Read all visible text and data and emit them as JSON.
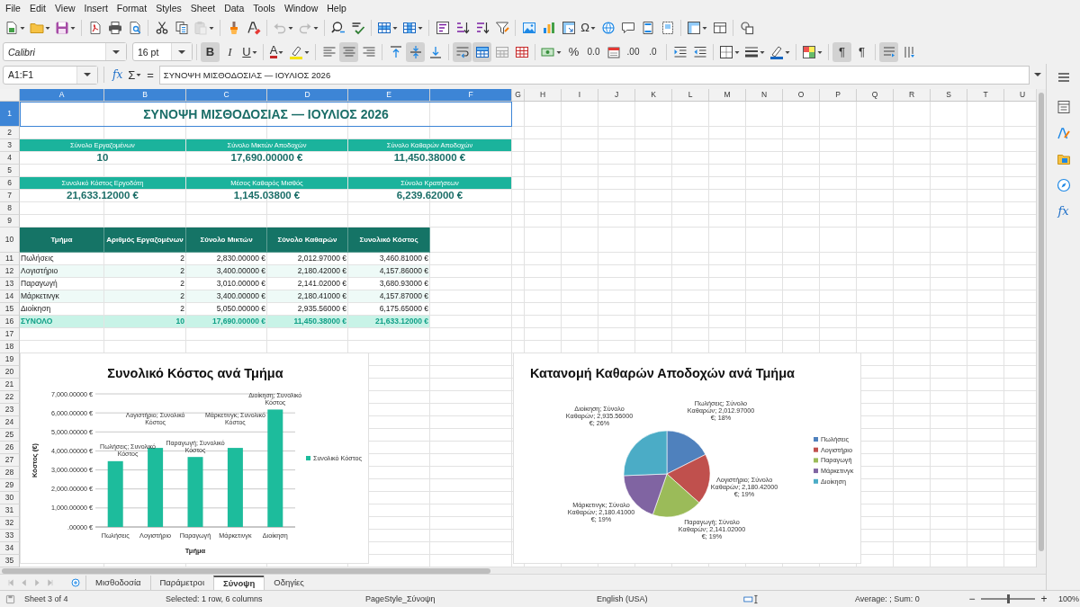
{
  "menu": [
    "File",
    "Edit",
    "View",
    "Insert",
    "Format",
    "Styles",
    "Sheet",
    "Data",
    "Tools",
    "Window",
    "Help"
  ],
  "toolbar_standard": [
    [
      {
        "kind": "new-document",
        "dropdown": true,
        "disabled": false
      },
      {
        "kind": "folder",
        "dropdown": true,
        "disabled": false
      },
      {
        "kind": "save",
        "dropdown": true,
        "disabled": false
      }
    ],
    [
      {
        "kind": "export-pdf",
        "dropdown": false,
        "disabled": false
      },
      {
        "kind": "print",
        "dropdown": false,
        "disabled": false
      },
      {
        "kind": "print-preview",
        "dropdown": false,
        "disabled": false
      }
    ],
    [
      {
        "kind": "cut",
        "dropdown": false,
        "disabled": false
      },
      {
        "kind": "copy",
        "dropdown": false,
        "disabled": false
      },
      {
        "kind": "paste",
        "dropdown": true,
        "disabled": true
      }
    ],
    [
      {
        "kind": "paintbrush",
        "dropdown": false,
        "disabled": false
      },
      {
        "kind": "clear-formatting",
        "dropdown": false,
        "disabled": false
      }
    ],
    [
      {
        "kind": "undo",
        "dropdown": true,
        "disabled": true
      },
      {
        "kind": "redo",
        "dropdown": true,
        "disabled": true
      }
    ],
    [
      {
        "kind": "find-replace",
        "dropdown": false,
        "disabled": false
      },
      {
        "kind": "spelling",
        "dropdown": false,
        "disabled": false
      }
    ],
    [
      {
        "kind": "insert-rows",
        "dropdown": true,
        "disabled": false
      },
      {
        "kind": "insert-columns",
        "dropdown": true,
        "disabled": false
      }
    ],
    [
      {
        "kind": "sort",
        "dropdown": false,
        "disabled": false
      },
      {
        "kind": "sort-ascending",
        "dropdown": false,
        "disabled": false
      },
      {
        "kind": "sort-descending",
        "dropdown": false,
        "disabled": false
      },
      {
        "kind": "filter",
        "dropdown": false,
        "disabled": false
      }
    ],
    [
      {
        "kind": "image",
        "dropdown": false,
        "disabled": false
      },
      {
        "kind": "chart",
        "dropdown": false,
        "disabled": false
      },
      {
        "kind": "pivot-table",
        "dropdown": false,
        "disabled": false
      },
      {
        "kind": "special-character",
        "label": "Ω",
        "dropdown": true,
        "disabled": false
      },
      {
        "kind": "hyperlink",
        "dropdown": false,
        "disabled": false
      },
      {
        "kind": "comment",
        "dropdown": false,
        "disabled": false
      },
      {
        "kind": "header-footer",
        "dropdown": false,
        "disabled": false
      },
      {
        "kind": "print-area",
        "dropdown": false,
        "disabled": false
      }
    ],
    [
      {
        "kind": "freeze",
        "dropdown": true,
        "disabled": false
      },
      {
        "kind": "split-window",
        "dropdown": false,
        "disabled": false
      }
    ],
    [
      {
        "kind": "shapes",
        "dropdown": false,
        "disabled": false
      }
    ]
  ],
  "toolbar_formatting": {
    "font_name": "Calibri",
    "font_size": "16 pt",
    "groups": [
      [
        {
          "kind": "bold",
          "label": "B",
          "dropdown": false,
          "pressed": true
        },
        {
          "kind": "italic",
          "label": "I",
          "dropdown": false,
          "pressed": false
        },
        {
          "kind": "underline",
          "label": "U",
          "dropdown": true,
          "pressed": false
        }
      ],
      [
        {
          "kind": "font-color",
          "label": "A",
          "dropdown": true,
          "pressed": false
        },
        {
          "kind": "highlight",
          "dropdown": true,
          "pressed": false
        }
      ],
      [
        {
          "kind": "align-left",
          "dropdown": false,
          "pressed": false
        },
        {
          "kind": "align-center",
          "dropdown": false,
          "pressed": true
        },
        {
          "kind": "align-right",
          "dropdown": false,
          "pressed": false
        }
      ],
      [
        {
          "kind": "align-top",
          "dropdown": false,
          "pressed": false
        },
        {
          "kind": "align-middle",
          "dropdown": false,
          "pressed": true
        },
        {
          "kind": "align-bottom",
          "dropdown": false,
          "pressed": false
        }
      ],
      [
        {
          "kind": "wrap-text",
          "dropdown": false,
          "pressed": true
        },
        {
          "kind": "merge-center",
          "dropdown": false,
          "pressed": true
        },
        {
          "kind": "merge-cells",
          "dropdown": false,
          "pressed": false
        },
        {
          "kind": "unmerge",
          "dropdown": false,
          "pressed": false
        }
      ],
      [
        {
          "kind": "currency",
          "dropdown": true,
          "pressed": false
        },
        {
          "kind": "percent",
          "label": "%",
          "dropdown": false,
          "pressed": false
        },
        {
          "kind": "number",
          "label": "0.0",
          "dropdown": false,
          "pressed": false
        },
        {
          "kind": "date",
          "dropdown": false,
          "pressed": false
        },
        {
          "kind": "add-decimal",
          "label": ".00",
          "dropdown": false,
          "pressed": false
        },
        {
          "kind": "delete-decimal",
          "label": ".0",
          "dropdown": false,
          "pressed": false
        }
      ],
      [
        {
          "kind": "indent-increase",
          "dropdown": false,
          "pressed": false
        },
        {
          "kind": "indent-decrease",
          "dropdown": false,
          "pressed": false
        }
      ],
      [
        {
          "kind": "borders",
          "dropdown": true,
          "pressed": false
        },
        {
          "kind": "border-style",
          "dropdown": true,
          "pressed": false
        },
        {
          "kind": "border-color",
          "dropdown": true,
          "pressed": false
        }
      ],
      [
        {
          "kind": "conditional",
          "dropdown": true,
          "pressed": false
        }
      ],
      [
        {
          "kind": "left-to-right",
          "label": "¶",
          "dropdown": false,
          "pressed": true
        },
        {
          "kind": "right-to-left",
          "label": "¶",
          "dropdown": false,
          "pressed": false
        }
      ],
      [
        {
          "kind": "text-direction",
          "dropdown": false,
          "pressed": true
        },
        {
          "kind": "vertical-text",
          "dropdown": false,
          "pressed": false
        }
      ]
    ]
  },
  "formula_bar": {
    "cell_reference": "A1:F1",
    "function_wizard": "fx",
    "sum": "Σ",
    "equals": "=",
    "content": "ΣΥΝΟΨΗ ΜΙΣΘΟΔΟΣΙΑΣ — ΙΟΥΛΙΟΣ 2026"
  },
  "sidebar": [
    {
      "kind": "menu"
    },
    {
      "kind": "properties"
    },
    {
      "kind": "styles"
    },
    {
      "kind": "gallery"
    },
    {
      "kind": "navigator"
    },
    {
      "kind": "functions",
      "label": "fx"
    }
  ],
  "sheet": {
    "columns": [
      {
        "label": "A",
        "selected": true
      },
      {
        "label": "B",
        "selected": true
      },
      {
        "label": "C",
        "selected": true
      },
      {
        "label": "D",
        "selected": true
      },
      {
        "label": "E",
        "selected": true
      },
      {
        "label": "F",
        "selected": true
      },
      {
        "label": "G",
        "selected": false
      },
      {
        "label": "H",
        "selected": false
      },
      {
        "label": "I",
        "selected": false
      },
      {
        "label": "J",
        "selected": false
      },
      {
        "label": "K",
        "selected": false
      },
      {
        "label": "L",
        "selected": false
      },
      {
        "label": "M",
        "selected": false
      },
      {
        "label": "N",
        "selected": false
      },
      {
        "label": "O",
        "selected": false
      },
      {
        "label": "P",
        "selected": false
      },
      {
        "label": "Q",
        "selected": false
      },
      {
        "label": "R",
        "selected": false
      },
      {
        "label": "S",
        "selected": false
      },
      {
        "label": "T",
        "selected": false
      },
      {
        "label": "U",
        "selected": false
      }
    ],
    "rows": [
      {
        "label": "1",
        "selected": true
      },
      {
        "label": "2",
        "selected": false
      },
      {
        "label": "3",
        "selected": false
      },
      {
        "label": "4",
        "selected": false
      },
      {
        "label": "5",
        "selected": false
      },
      {
        "label": "6",
        "selected": false
      },
      {
        "label": "7",
        "selected": false
      },
      {
        "label": "8",
        "selected": false
      },
      {
        "label": "9",
        "selected": false
      },
      {
        "label": "10",
        "selected": false
      },
      {
        "label": "11",
        "selected": false
      },
      {
        "label": "12",
        "selected": false
      },
      {
        "label": "13",
        "selected": false
      },
      {
        "label": "14",
        "selected": false
      },
      {
        "label": "15",
        "selected": false
      },
      {
        "label": "16",
        "selected": false
      },
      {
        "label": "17",
        "selected": false
      },
      {
        "label": "18",
        "selected": false
      },
      {
        "label": "19",
        "selected": false
      },
      {
        "label": "20",
        "selected": false
      },
      {
        "label": "21",
        "selected": false
      },
      {
        "label": "22",
        "selected": false
      },
      {
        "label": "23",
        "selected": false
      },
      {
        "label": "24",
        "selected": false
      },
      {
        "label": "25",
        "selected": false
      },
      {
        "label": "26",
        "selected": false
      },
      {
        "label": "27",
        "selected": false
      },
      {
        "label": "28",
        "selected": false
      },
      {
        "label": "29",
        "selected": false
      },
      {
        "label": "30",
        "selected": false
      },
      {
        "label": "31",
        "selected": false
      },
      {
        "label": "32",
        "selected": false
      },
      {
        "label": "33",
        "selected": false
      },
      {
        "label": "34",
        "selected": false
      },
      {
        "label": "35",
        "selected": false
      }
    ],
    "title": "ΣΥΝΟΨΗ ΜΙΣΘΟΔΟΣΙΑΣ — ΙΟΥΛΙΟΣ 2026",
    "kpi_rows": [
      [
        {
          "label": "Σύνολο Εργαζομένων",
          "value": "10"
        },
        {
          "label": "Σύνολο Μικτών Αποδοχών",
          "value": "17,690.00000 €"
        },
        {
          "label": "Σύνολο Καθαρών Αποδοχών",
          "value": "11,450.38000 €"
        }
      ],
      [
        {
          "label": "Συνολικό Κόστος Εργοδότη",
          "value": "21,633.12000 €"
        },
        {
          "label": "Μέσος Καθαρός Μισθός",
          "value": "1,145.03800 €"
        },
        {
          "label": "Σύνολο Κρατήσεων",
          "value": "6,239.62000 €"
        }
      ]
    ],
    "table": {
      "columns": [
        "Τμήμα",
        "Αριθμός Εργαζομένων",
        "Σύνολο Μικτών",
        "Σύνολο Καθαρών",
        "Συνολικό Κόστος"
      ],
      "rows": [
        [
          "Πωλήσεις",
          "2",
          "2,830.00000 €",
          "2,012.97000 €",
          "3,460.81000 €"
        ],
        [
          "Λογιστήριο",
          "2",
          "3,400.00000 €",
          "2,180.42000 €",
          "4,157.86000 €"
        ],
        [
          "Παραγωγή",
          "2",
          "3,010.00000 €",
          "2,141.02000 €",
          "3,680.93000 €"
        ],
        [
          "Μάρκετινγκ",
          "2",
          "3,400.00000 €",
          "2,180.41000 €",
          "4,157.87000 €"
        ],
        [
          "Διοίκηση",
          "2",
          "5,050.00000 €",
          "2,935.56000 €",
          "6,175.65000 €"
        ]
      ],
      "total": [
        "ΣΥΝΟΛΟ",
        "10",
        "17,690.00000 €",
        "11,450.38000 €",
        "21,633.12000 €"
      ]
    }
  },
  "charts": [
    {
      "chart_data": {
        "type": "bar",
        "grid": true,
        "legend": true,
        "title": "Συνολικό Κόστος ανά Τμήμα",
        "xlabel": "Τμήμα",
        "ylabel": "Κόστος (€)",
        "categories": [
          "Πωλήσεις",
          "Λογιστήριο",
          "Παραγωγή",
          "Μάρκετινγκ",
          "Διοίκηση"
        ],
        "series": [
          {
            "name": "Συνολικό Κόστος",
            "color": "#1dbc9c",
            "values": [
              3460.81,
              4157.86,
              3680.93,
              4157.87,
              6175.65
            ]
          }
        ],
        "ylim": [
          0,
          7000
        ],
        "yticks": [
          {
            "value": 0,
            "label": ".00000 €"
          },
          {
            "value": 1000,
            "label": "1,000.00000 €"
          },
          {
            "value": 2000,
            "label": "2,000.00000 €"
          },
          {
            "value": 3000,
            "label": "3,000.00000 €"
          },
          {
            "value": 4000,
            "label": "4,000.00000 €"
          },
          {
            "value": 5000,
            "label": "5,000.00000 €"
          },
          {
            "value": 6000,
            "label": "6,000.00000 €"
          },
          {
            "value": 7000,
            "label": "7,000.00000 €"
          }
        ],
        "value_labels": [
          "Πωλήσεις; Συνολικό Κόστος",
          "Λογιστήριο; Συνολικό Κόστος",
          "Παραγωγή; Συνολικό Κόστος",
          "Μάρκετινγκ; Συνολικό Κόστος",
          "Διοίκηση; Συνολικό Κόστος"
        ]
      }
    },
    {
      "chart_data": {
        "type": "pie",
        "legend": true,
        "title": "Κατανομή Καθαρών Αποδοχών ανά Τμήμα",
        "categories": [
          "Πωλήσεις",
          "Λογιστήριο",
          "Παραγωγή",
          "Μάρκετινγκ",
          "Διοίκηση"
        ],
        "series": [
          {
            "values": [
              17.58,
              19.04,
              18.7,
              19.04,
              25.64
            ],
            "colors": [
              "#4f81bd",
              "#c0504d",
              "#9bbb59",
              "#8064a2",
              "#4bacc6"
            ]
          }
        ],
        "value_labels": [
          "Πωλήσεις; Σύνολο Καθαρών; 2,012.97000 €; 18%",
          "Λογιστήριο; Σύνολο Καθαρών; 2,180.42000 €; 19%",
          "Παραγωγή; Σύνολο Καθαρών; 2,141.02000 €; 19%",
          "Μάρκετινγκ; Σύνολο Καθαρών; 2,180.41000 €; 19%",
          "Διοίκηση; Σύνολο Καθαρών; 2,935.56000 €; 26%"
        ]
      }
    }
  ],
  "sheet_tabs": [
    {
      "label": "Μισθοδοσία",
      "selected": false
    },
    {
      "label": "Παράμετροι",
      "selected": false
    },
    {
      "label": "Σύνοψη",
      "selected": true
    },
    {
      "label": "Οδηγίες",
      "selected": false
    }
  ],
  "status_bar": {
    "sheet": "Sheet 3 of 4",
    "selection": "Selected: 1 row, 6 columns",
    "page_style": "PageStyle_Σύνοψη",
    "language": "English (USA)",
    "statistics": "Average: ; Sum: 0",
    "zoom_out": "−",
    "zoom": {
      "level": 0.5
    },
    "zoom_in": "+",
    "zoom_percent": "100%"
  }
}
